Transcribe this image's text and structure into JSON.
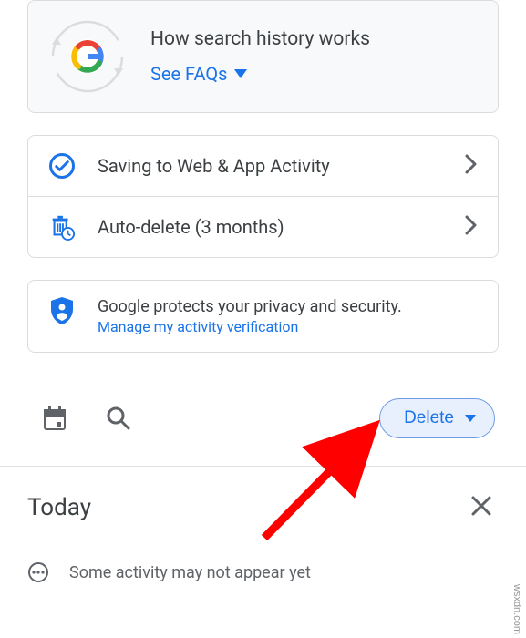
{
  "faq": {
    "title": "How search history works",
    "link_label": "See FAQs"
  },
  "options": {
    "saving_label": "Saving to Web & App Activity",
    "autodelete_label": "Auto-delete (3 months)"
  },
  "privacy": {
    "text": "Google protects your privacy and security.",
    "link": "Manage my activity verification"
  },
  "toolbar": {
    "delete_label": "Delete"
  },
  "section": {
    "today_label": "Today"
  },
  "notice": {
    "text": "Some activity may not appear yet"
  },
  "watermark": "wsxdn.com",
  "colors": {
    "link": "#1a73e8",
    "border": "#dadce0",
    "text": "#3c4043",
    "muted": "#5f6368",
    "arrow": "#ff0000"
  }
}
